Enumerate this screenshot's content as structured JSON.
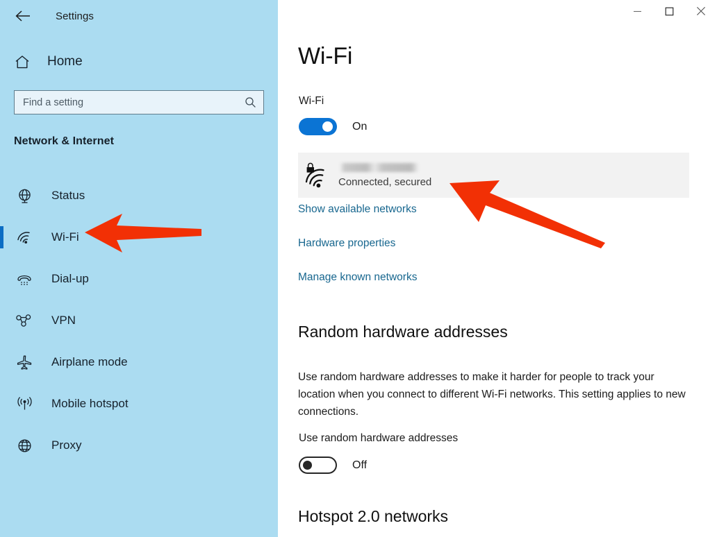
{
  "window": {
    "app_title": "Settings",
    "back_icon": "back-arrow-icon",
    "controls": {
      "minimize": "minimize-icon",
      "maximize": "maximize-icon",
      "close": "close-icon"
    }
  },
  "sidebar": {
    "home_label": "Home",
    "home_icon": "home-icon",
    "search": {
      "placeholder": "Find a setting",
      "value": "",
      "icon": "search-icon"
    },
    "category": "Network & Internet",
    "items": [
      {
        "label": "Status",
        "icon": "globe-icon",
        "selected": false
      },
      {
        "label": "Wi-Fi",
        "icon": "wifi-icon",
        "selected": true
      },
      {
        "label": "Dial-up",
        "icon": "dialup-phone-icon",
        "selected": false
      },
      {
        "label": "VPN",
        "icon": "vpn-icon",
        "selected": false
      },
      {
        "label": "Airplane mode",
        "icon": "airplane-icon",
        "selected": false
      },
      {
        "label": "Mobile hotspot",
        "icon": "hotspot-icon",
        "selected": false
      },
      {
        "label": "Proxy",
        "icon": "globe-icon",
        "selected": false
      }
    ]
  },
  "main": {
    "page_title": "Wi-Fi",
    "wifi_toggle": {
      "label": "Wi-Fi",
      "state": "On",
      "checked": true
    },
    "network": {
      "name": "",
      "name_redacted": true,
      "status": "Connected, secured",
      "lock_icon": "lock-icon",
      "signal_icon": "wifi-signal-icon"
    },
    "links": [
      {
        "label": "Show available networks"
      },
      {
        "label": "Hardware properties"
      },
      {
        "label": "Manage known networks"
      }
    ],
    "random_mac": {
      "heading": "Random hardware addresses",
      "description": "Use random hardware addresses to make it harder for people to track your location when you connect to different Wi-Fi networks. This setting applies to new connections.",
      "toggle_label": "Use random hardware addresses",
      "state": "Off",
      "checked": false
    },
    "hotspot_heading": "Hotspot 2.0 networks"
  },
  "annotations": {
    "arrow_color": "#f23005",
    "arrows": [
      {
        "name": "arrow-pointing-wifi-sidebar-item",
        "direction": "left"
      },
      {
        "name": "arrow-pointing-connected-network",
        "direction": "up-left"
      }
    ]
  },
  "colors": {
    "sidebar_bg": "#abdcf1",
    "accent": "#0b6dc4",
    "toggle_on": "#0b74d4",
    "link": "#18678f",
    "card_bg": "#f2f2f2"
  }
}
